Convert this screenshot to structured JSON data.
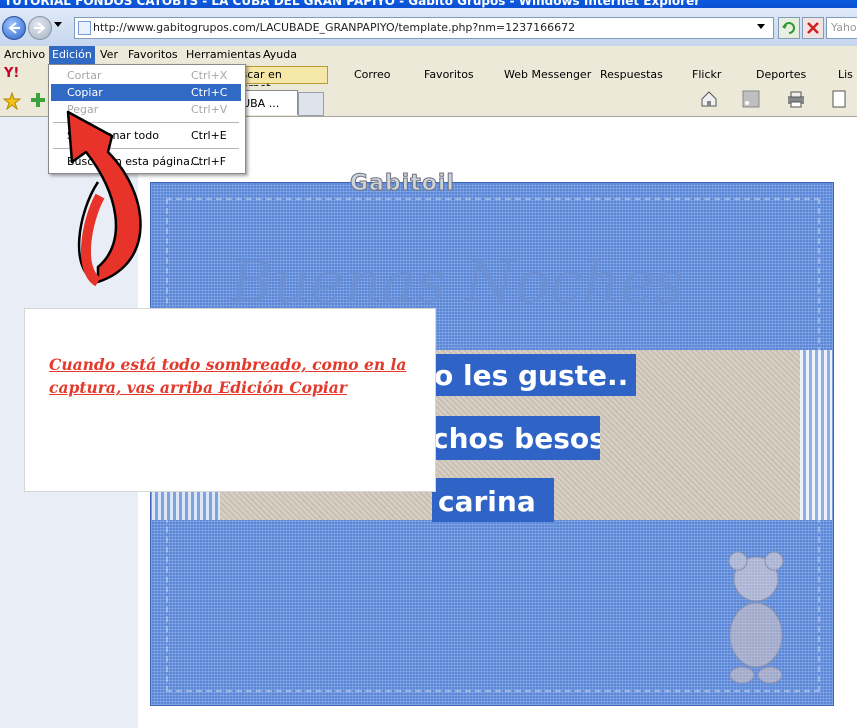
{
  "window": {
    "title": "TUTORIAL FONDOS CATOBTS - LA CUBA DEL GRAN PAPIYO - Gabito Grupos - Windows Internet Explorer"
  },
  "address_bar": {
    "url": "http://www.gabitogrupos.com/LACUBADE_GRANPAPIYO/template.php?nm=1237166672",
    "search_placeholder": "Yaho"
  },
  "menu": {
    "items": [
      "Archivo",
      "Edición",
      "Ver",
      "Favoritos",
      "Herramientas",
      "Ayuda"
    ],
    "selected": "Edición"
  },
  "yahoo_toolbar": {
    "search_label": "Buscar en Internet",
    "items": [
      "Correo",
      "Favoritos",
      "Web Messenger",
      "Respuestas",
      "Flickr",
      "Deportes",
      "Lis"
    ]
  },
  "tab": {
    "label": "LA CUBA ..."
  },
  "edit_menu": {
    "items": [
      {
        "label": "Cortar",
        "shortcut": "Ctrl+X",
        "state": "disabled"
      },
      {
        "label": "Copiar",
        "shortcut": "Ctrl+C",
        "state": "highlighted"
      },
      {
        "label": "Pegar",
        "shortcut": "Ctrl+V",
        "state": "disabled"
      },
      {
        "label": "Seleccionar todo",
        "shortcut": "Ctrl+E",
        "state": "normal"
      },
      {
        "label": "Buscar en esta página...",
        "shortcut": "Ctrl+F",
        "state": "normal"
      }
    ]
  },
  "page": {
    "logo_text": "Gabitoil",
    "heading_text": "Buenas Noches",
    "message_lines": [
      "o les guste..",
      "chos besos",
      "carina"
    ]
  },
  "note": {
    "text": "Cuando está todo sombreado, como en la captura, vas arriba Edición Copiar"
  },
  "colors": {
    "note_text": "#e33a2c",
    "selection_blue": "#316ac5",
    "stationery_blue": "#5b87d9"
  }
}
